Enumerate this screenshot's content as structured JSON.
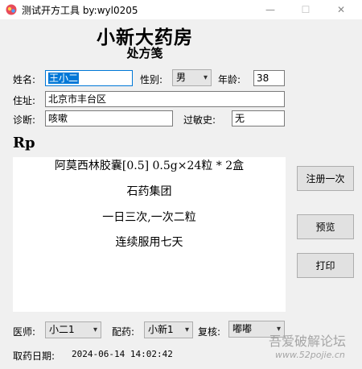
{
  "window": {
    "title": "测试开方工具 by:wyl0205",
    "min_symbol": "—",
    "max_symbol": "☐",
    "close_symbol": "✕"
  },
  "header": {
    "store_name": "小新大药房",
    "form_title": "处方笺"
  },
  "patient": {
    "name_label": "姓名:",
    "name_value": "王小二",
    "gender_label": "性别:",
    "gender_value": "男",
    "age_label": "年龄:",
    "age_value": "38",
    "address_label": "住址:",
    "address_value": "北京市丰台区",
    "diagnosis_label": "诊断:",
    "diagnosis_value": "咳嗽",
    "allergy_label": "过敏史:",
    "allergy_value": "无"
  },
  "prescription": {
    "rp_label": "Rp",
    "lines": [
      "阿莫西林胶囊[0.5] 0.5g×24粒 * 2盒",
      "石药集团",
      "一日三次,一次二粒",
      "连续服用七天"
    ]
  },
  "buttons": {
    "register": "注册一次",
    "preview": "预览",
    "print": "打印"
  },
  "footer": {
    "doctor_label": "医师:",
    "doctor_value": "小二1",
    "dispense_label": "配药:",
    "dispense_value": "小新1",
    "review_label": "复核:",
    "review_value": "嘟嘟",
    "date_label": "取药日期:",
    "date_value": "2024-06-14 14:02:42"
  },
  "watermark": {
    "text": "吾爱破解论坛",
    "url": "www.52pojie.cn"
  },
  "colors": {
    "accent": "#0078d7",
    "window_bg": "#f0f0f0"
  }
}
